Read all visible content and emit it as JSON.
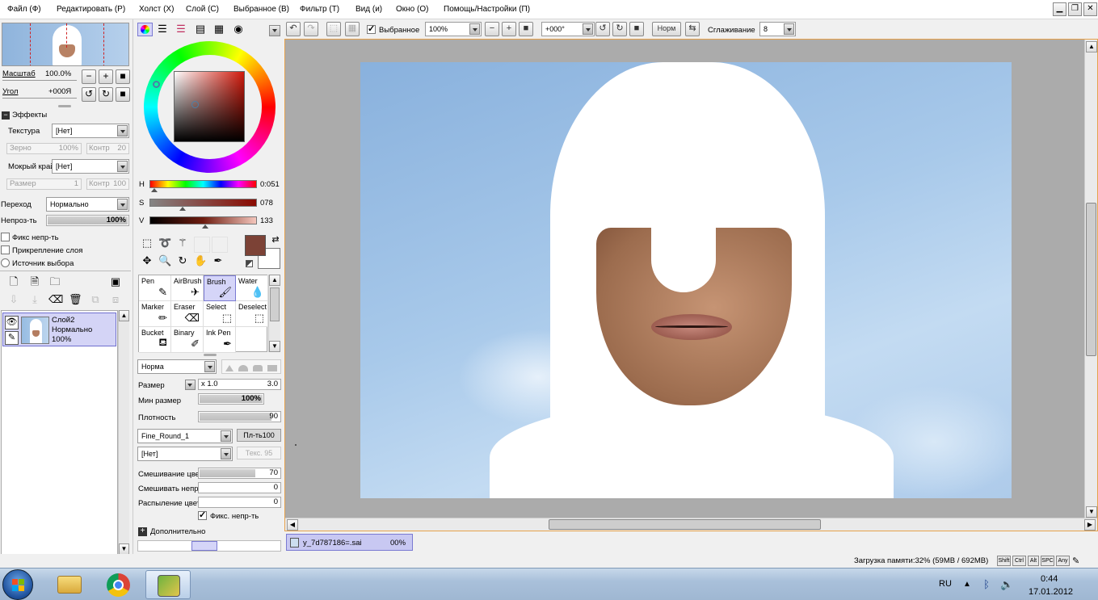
{
  "menu": [
    "Файл (Ф)",
    "Редактировать (Р)",
    "Холст (Х)",
    "Слой (С)",
    "Выбранное (В)",
    "Фильтр (Т)",
    "Вид (и)",
    "Окно (О)",
    "Помощь/Настройки (П)"
  ],
  "toolbar": {
    "selection_label": "Выбранное",
    "zoom": "100%",
    "angle": "+000°",
    "blend": "Норм",
    "smoothing_label": "Сглаживание",
    "smoothing_value": "8"
  },
  "navigator": {
    "scale_label": "Масштаб",
    "scale_value": "100.0%",
    "angle_label": "Угол",
    "angle_value": "+000Я"
  },
  "effects": {
    "title": "Эффекты",
    "texture_label": "Текстура",
    "texture_value": "[Нет]",
    "grain_label": "Зерно",
    "grain_value": "100%",
    "contrast_label": "Контр",
    "contrast_value": "20",
    "wet_label": "Мокрый край",
    "wet_value": "[Нет]",
    "size_label": "Размер",
    "size_value": "1",
    "contrast2_label": "Контр",
    "contrast2_value": "100"
  },
  "layer_props": {
    "mode_label": "Переход",
    "mode_value": "Нормально",
    "opacity_label": "Непроз-ть",
    "opacity_value": "100%",
    "opacity_fraction": 1.0,
    "lock_opacity": "Фикс непр-ть",
    "clipping": "Прикрепление слоя",
    "selection_source": "Источник выбора"
  },
  "layer": {
    "name": "Слой2",
    "mode": "Нормально",
    "opacity": "100%"
  },
  "color": {
    "h_label": "H",
    "h_value": "0:051",
    "s_label": "S",
    "s_value": "078",
    "v_label": "V",
    "v_value": "133",
    "primary": "#7c4236",
    "secondary": "#ffffff"
  },
  "tools": [
    {
      "label": "Pen",
      "icon": "pen-icon"
    },
    {
      "label": "AirBrush",
      "icon": "airbrush-icon"
    },
    {
      "label": "Brush",
      "icon": "brush-icon"
    },
    {
      "label": "Water",
      "icon": "water-icon"
    },
    {
      "label": "Marker",
      "icon": "marker-icon"
    },
    {
      "label": "Eraser",
      "icon": "eraser-icon"
    },
    {
      "label": "Select",
      "icon": "select-icon"
    },
    {
      "label": "Deselect",
      "icon": "deselect-icon"
    },
    {
      "label": "Bucket",
      "icon": "bucket-icon"
    },
    {
      "label": "Binary",
      "icon": "binary-icon"
    },
    {
      "label": "Ink Pen",
      "icon": "inkpen-icon"
    }
  ],
  "brush": {
    "blend": "Норма",
    "size_label": "Размер",
    "size_mult": "x 1.0",
    "size_value": "3.0",
    "min_size_label": "Мин размер",
    "min_size_value": "100%",
    "min_size_fraction": 1.0,
    "density_label": "Плотность",
    "density_value": "90",
    "density_fraction": 0.9,
    "shape": "Fine_Round_1",
    "shape_strength": "Пл-ть100",
    "texture": "[Нет]",
    "texture_strength": "Текс. 95",
    "blending_label": "Смешивание цве",
    "blending_value": "70",
    "blending_fraction": 0.7,
    "dilution_label": "Смешивать непро",
    "dilution_value": "0",
    "persistence_label": "Распыление цвет",
    "persistence_value": "0",
    "keep_opacity": "Фикс. непр-ть",
    "advanced": "Дополнительно"
  },
  "document_tab": {
    "name": "y_7d787186=.sai",
    "zoom": "00%"
  },
  "status": {
    "memory": "Загрузка памяти:32% (59MB / 692MB)",
    "keys": [
      "Shift",
      "Ctrl",
      "Alt",
      "SPC",
      "Any"
    ]
  },
  "taskbar": {
    "lang": "RU",
    "time": "0:44",
    "date": "17.01.2012"
  }
}
